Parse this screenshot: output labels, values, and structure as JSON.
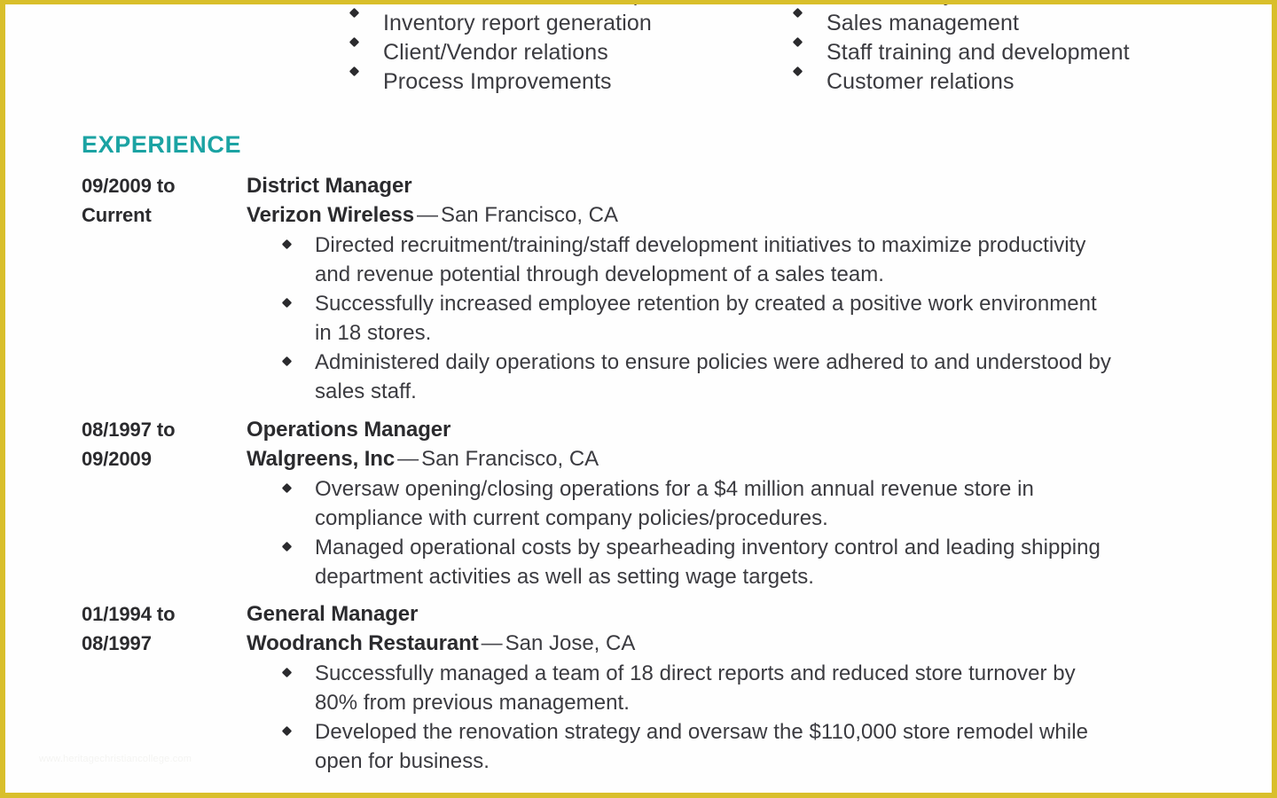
{
  "theme": {
    "border_color": "#d9bf2b",
    "heading_color": "#1ba3a3",
    "text_color": "#3b3b40",
    "strong_text_color": "#2b2b2e",
    "page_background": "#fefefe"
  },
  "skills": {
    "left_column": [
      "Executive team leadership",
      "Inventory report generation",
      "Client/Vendor relations",
      "Process Improvements"
    ],
    "right_column": [
      "Market analysis",
      "Sales management",
      "Staff training and development",
      "Customer relations"
    ]
  },
  "experience": {
    "heading": "EXPERIENCE",
    "jobs": [
      {
        "dates": "09/2009 to Current",
        "title": "District Manager",
        "organization": "Verizon Wireless",
        "separator": "—",
        "location": "San Francisco, CA",
        "bullets": [
          "Directed recruitment/training/staff development initiatives to maximize productivity and revenue potential through development of a sales team.",
          "Successfully increased employee retention by created a positive work environment in 18 stores.",
          "Administered daily operations to ensure policies were adhered to and understood by sales staff."
        ]
      },
      {
        "dates": "08/1997 to 09/2009",
        "title": "Operations Manager",
        "organization": "Walgreens, Inc",
        "separator": "—",
        "location": "San Francisco, CA",
        "bullets": [
          "Oversaw opening/closing operations for a $4 million annual revenue store in compliance with current company policies/procedures.",
          "Managed operational costs by spearheading inventory control and leading shipping department activities as well as setting wage targets."
        ]
      },
      {
        "dates": "01/1994 to 08/1997",
        "title": "General Manager",
        "organization": "Woodranch Restaurant",
        "separator": "—",
        "location": "San Jose, CA",
        "bullets": [
          "Successfully managed a team of 18 direct reports and reduced store turnover by 80% from previous management.",
          "Developed the renovation strategy and oversaw the $110,000 store remodel while open for business."
        ]
      }
    ]
  },
  "watermark": "www.heritagechristiancollege.com"
}
